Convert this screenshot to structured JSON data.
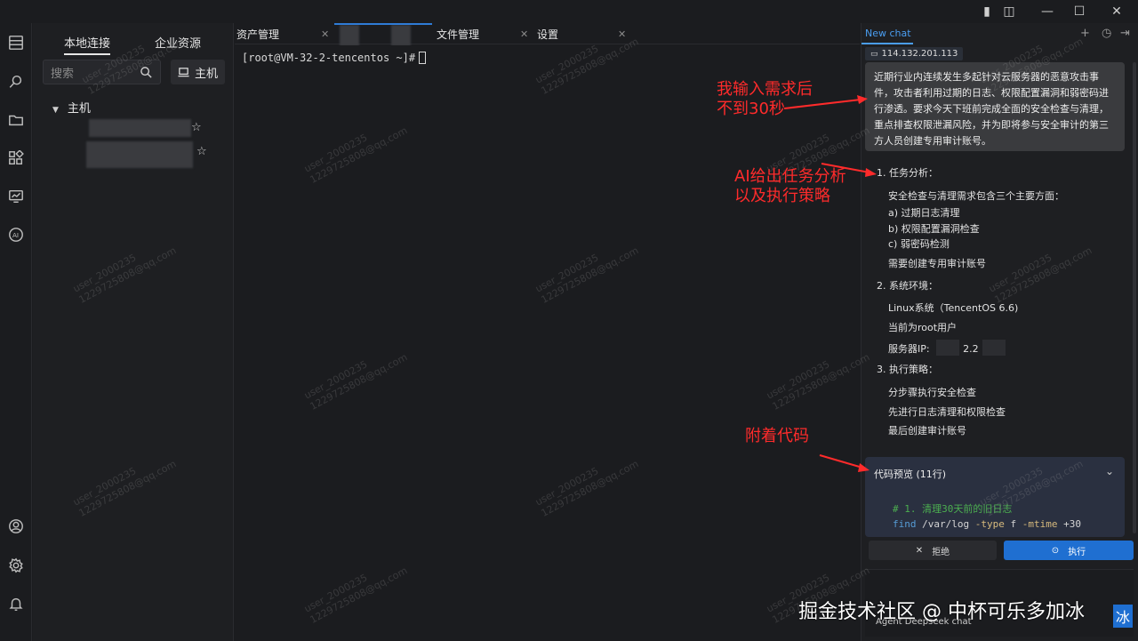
{
  "window": {
    "controls": [
      "▢",
      "▯",
      "—",
      "☐",
      "✕"
    ]
  },
  "connections": {
    "tabs": [
      "本地连接",
      "企业资源"
    ],
    "search_placeholder": "搜索",
    "host_button": "主机",
    "tree_root": "主机"
  },
  "tabs": [
    {
      "label": "资产管理"
    },
    {
      "label": "文件管理"
    },
    {
      "label": "设置"
    }
  ],
  "terminal": {
    "prompt": "[root@VM-32-2-tencentos ~]#"
  },
  "chat": {
    "tab_label": "New chat",
    "ip": "114.132.201.113",
    "user_message": "近期行业内连续发生多起针对云服务器的恶意攻击事件，攻击者利用过期的日志、权限配置漏洞和弱密码进行渗透。要求今天下班前完成全面的安全检查与清理，重点排查权限泄漏风险，并为即将参与安全审计的第三方人员创建专用审计账号。",
    "sections": [
      {
        "heading": "1. 任务分析：",
        "items": [
          "安全检查与清理需求包含三个主要方面：",
          "a) 过期日志清理",
          "b) 权限配置漏洞检查",
          "c) 弱密码检测",
          "需要创建专用审计账号"
        ]
      },
      {
        "heading": "2. 系统环境：",
        "items": [
          "Linux系统（TencentOS 6.6)",
          "当前为root用户",
          "服务器IP:"
        ]
      },
      {
        "heading": "3. 执行策略：",
        "items": [
          "分步骤执行安全检查",
          "先进行日志清理和权限检查",
          "最后创建审计账号"
        ]
      }
    ],
    "server_ip_partial": "2.2",
    "code_preview": {
      "title": "代码预览 (11行)",
      "line1": "# 1. 清理30天前的旧日志",
      "line2_cmd": "find",
      "line2_rest": " /var/log ",
      "line2_opt1": "-type",
      "line2_mid": " f ",
      "line2_opt2": "-mtime",
      "line2_num": " +30"
    },
    "reject_label": "拒绝",
    "execute_label": "执行",
    "footer": "Agent   Deepseek chat"
  },
  "annotations": {
    "a1": [
      "我输入需求后",
      "不到30秒"
    ],
    "a2": [
      "AI给出任务分析",
      "以及执行策略"
    ],
    "a3": "附着代码"
  },
  "watermark": [
    "user_2000235",
    "1229725808@qq.com"
  ],
  "credit": "掘金技术社区 @ 中杯可乐多加冰",
  "credit_tail": "冰",
  "colors": {
    "accent": "#1f6fd1",
    "annotation": "#ff2b2b",
    "comment": "#4caf50",
    "keyword": "#569cd6",
    "option": "#d7ba7d"
  }
}
